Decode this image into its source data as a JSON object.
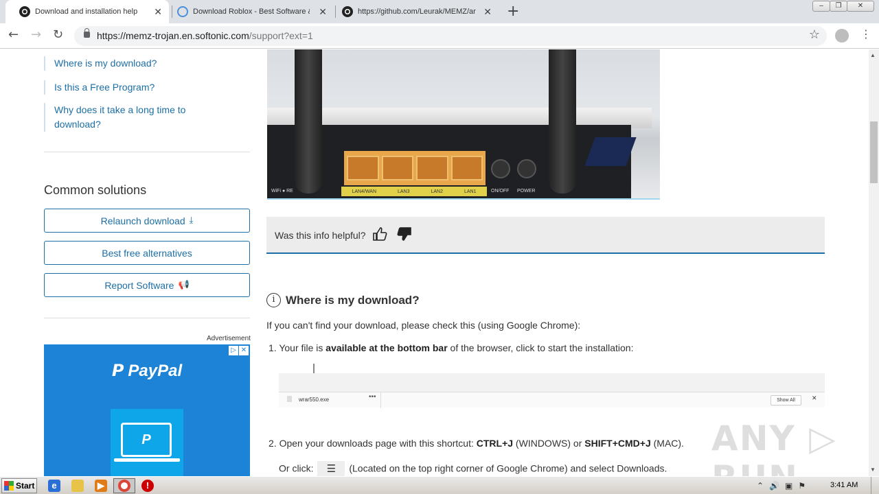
{
  "browser": {
    "tabs": [
      {
        "title": "Download and installation help",
        "active": true,
        "favicon": "github-icon"
      },
      {
        "title": "Download Roblox - Best Software &",
        "active": false,
        "favicon": "softonic-icon"
      },
      {
        "title": "https://github.com/Leurak/MEMZ/ar",
        "active": false,
        "favicon": "github-icon"
      }
    ],
    "close_glyph": "✕",
    "new_tab_glyph": "+",
    "url_host": "https://memz-trojan.en.softonic.com",
    "url_rest": "/support?ext=1",
    "window_controls": [
      "–",
      "❐",
      "✕"
    ]
  },
  "sidebar": {
    "faq_links": [
      "Where is my download?",
      "Is this a Free Program?",
      "Why does it take a long time to download?"
    ],
    "common_solutions_title": "Common solutions",
    "buttons": [
      {
        "label": "Relaunch download",
        "icon": "download-icon",
        "glyph": "⤓"
      },
      {
        "label": "Best free alternatives",
        "icon": "",
        "glyph": ""
      },
      {
        "label": "Report Software",
        "icon": "megaphone-icon",
        "glyph": "📢"
      }
    ],
    "ad_label": "Advertisement",
    "ad_brand": "PayPal",
    "ad_badge": [
      "▷",
      "✕"
    ],
    "ad_logo_letter": "P"
  },
  "router_image": {
    "port_labels": [
      "LAN4/WAN",
      "LAN3",
      "LAN2",
      "LAN1"
    ],
    "left_labels": "WiFi ● RE",
    "onoff": "ON/OFF",
    "power": "POWER"
  },
  "helpful": {
    "question": "Was this info helpful?",
    "thumbs_up": "👍",
    "thumbs_down": "👎"
  },
  "article": {
    "heading": "Where is my download?",
    "info_glyph": "i",
    "intro": "If you can't find your download, please check this (using Google Chrome):",
    "step1_num": "1.",
    "step1_pre": "Your file is ",
    "step1_bold": "available at the bottom bar",
    "step1_post": " of the browser, click to start the installation:",
    "download_bar": {
      "file": "wrar550.exe",
      "dots": "•••",
      "show_all": "Show All",
      "close": "✕"
    },
    "step2_num": "2.",
    "step2_pre": "Open your downloads page with this shortcut: ",
    "step2_k1": "CTRL+J",
    "step2_mid": " (WINDOWS) or ",
    "step2_k2": "SHIFT+CMD+J",
    "step2_post": " (MAC).",
    "step3_pre": "Or click: ",
    "step3_chip": "☰",
    "step3_post": " (Located on the top right corner of Google Chrome) and select Downloads."
  },
  "watermark": "ANY ▷ RUN",
  "taskbar": {
    "start_label": "Start",
    "clock": "3:41 AM"
  },
  "colors": {
    "link": "#1c6fa6",
    "ad_bg": "#1c83d6",
    "helpful_bg": "#ececec"
  }
}
